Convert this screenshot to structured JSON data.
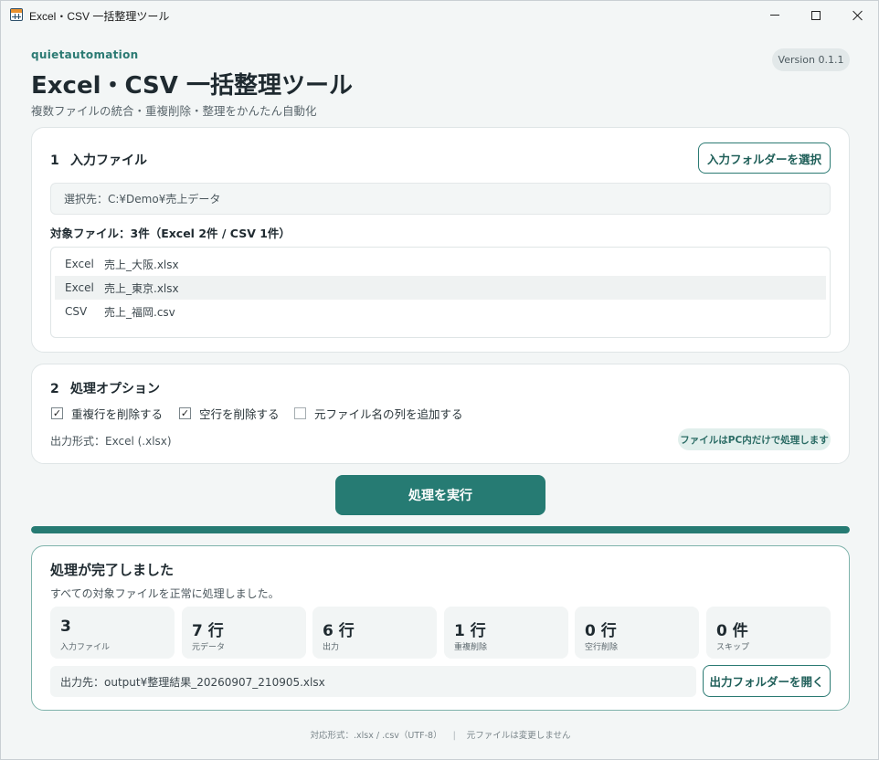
{
  "window": {
    "title": "Excel・CSV 一括整理ツール"
  },
  "header": {
    "brand": "quietautomation",
    "title": "Excel・CSV 一括整理ツール",
    "subtitle": "複数ファイルの統合・重複削除・整理をかんたん自動化",
    "version": "Version 0.1.1"
  },
  "input_section": {
    "number": "1",
    "title": "入力ファイル",
    "select_button": "入力フォルダーを選択",
    "selected_path": "選択先：C:¥Demo¥売上データ",
    "target_summary": "対象ファイル：3件（Excel 2件 / CSV 1件）",
    "files": [
      {
        "type": "Excel",
        "name": "売上_大阪.xlsx"
      },
      {
        "type": "Excel",
        "name": "売上_東京.xlsx"
      },
      {
        "type": "CSV",
        "name": "売上_福岡.csv"
      }
    ]
  },
  "options_section": {
    "number": "2",
    "title": "処理オプション",
    "options": [
      {
        "label": "重複行を削除する",
        "checked": true
      },
      {
        "label": "空行を削除する",
        "checked": true
      },
      {
        "label": "元ファイル名の列を追加する",
        "checked": false
      }
    ],
    "output_format": "出力形式：Excel (.xlsx)",
    "local_note": "ファイルはPC内だけで処理します"
  },
  "run_button": "処理を実行",
  "progress": {
    "fraction": 1.0,
    "color": "#267b73"
  },
  "result": {
    "title": "処理が完了しました",
    "message": "すべての対象ファイルを正常に処理しました。",
    "stats": [
      {
        "value": "3",
        "label": "入力ファイル"
      },
      {
        "value": "7 行",
        "label": "元データ"
      },
      {
        "value": "6 行",
        "label": "出力"
      },
      {
        "value": "1 行",
        "label": "重複削除"
      },
      {
        "value": "0 行",
        "label": "空行削除"
      },
      {
        "value": "0 件",
        "label": "スキップ"
      }
    ],
    "output_path": "出力先：output¥整理結果_20260907_210905.xlsx",
    "open_button": "出力フォルダーを開く"
  },
  "footer": {
    "formats": "対応形式：.xlsx / .csv（UTF-8）",
    "separator": "|",
    "note": "元ファイルは変更しません"
  },
  "colors": {
    "accent": "#267b73",
    "brand": "#2b7a73"
  }
}
